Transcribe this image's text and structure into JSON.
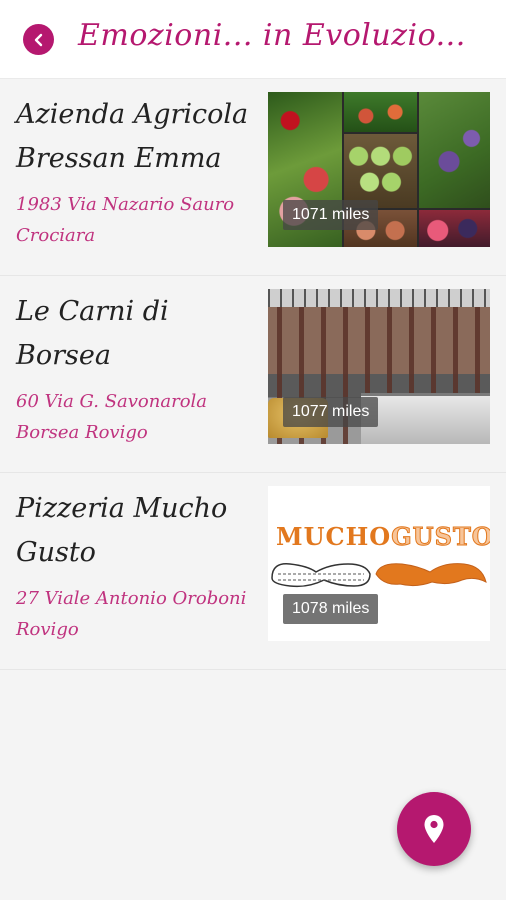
{
  "app": {
    "title": "Emozioni... in Evoluzio...",
    "accent_color": "#b5186f",
    "back_icon": "chevron-left-icon",
    "fab_icon": "map-pin-icon"
  },
  "places": [
    {
      "name": "Azienda Agricola Bressan Emma",
      "address": "1983 Via Nazario Sauro Crociara",
      "distance": "1071 miles",
      "image": "fruit-collage"
    },
    {
      "name": "Le Carni di Borsea",
      "address": "60 Via G. Savonarola Borsea Rovigo",
      "distance": "1077 miles",
      "image": "butcher-shop"
    },
    {
      "name": "Pizzeria Mucho Gusto",
      "address": "27 Viale Antonio Oroboni Rovigo",
      "distance": "1078 miles",
      "image": "mucho-gusto-logo",
      "logo_text_left": "MUCHO",
      "logo_text_right": "GUSTO"
    }
  ]
}
